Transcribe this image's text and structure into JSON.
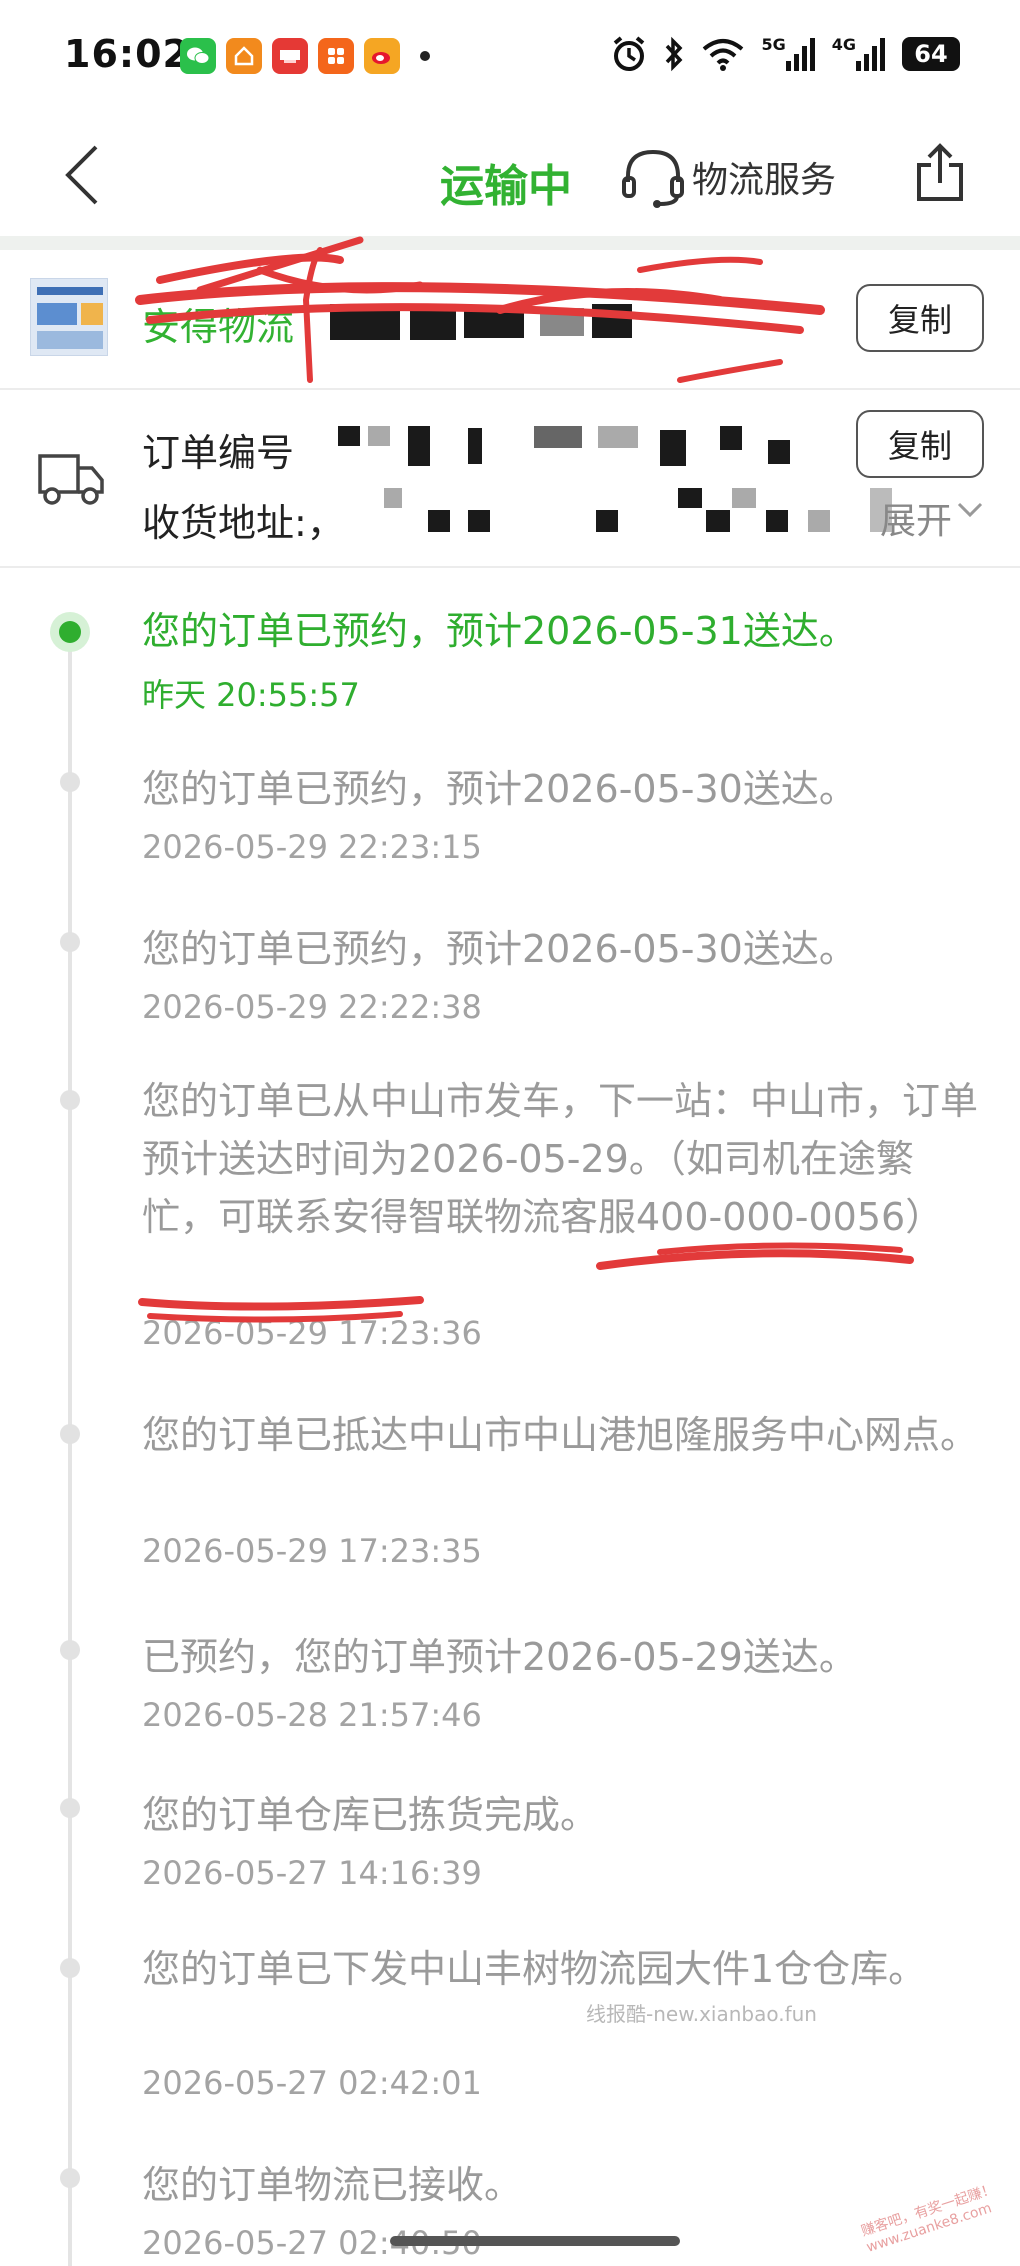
{
  "status_bar": {
    "time": "16:02",
    "network_5g": "5G",
    "network_4g": "4G",
    "battery": "64"
  },
  "nav": {
    "title": "运输中",
    "service_label": "物流服务"
  },
  "carrier": {
    "name": "安得物流",
    "copy_label": "复制"
  },
  "order": {
    "order_label": "订单编号",
    "address_label": "收货地址:，",
    "expand_label": "展开",
    "copy_label": "复制"
  },
  "timeline": [
    {
      "text": "您的订单已预约，预计2026-05-31送达。",
      "time": "昨天 20:55:57",
      "active": true
    },
    {
      "text": "您的订单已预约，预计2026-05-30送达。",
      "time": "2026-05-29 22:23:15"
    },
    {
      "text": "您的订单已预约，预计2026-05-30送达。",
      "time": "2026-05-29 22:22:38"
    },
    {
      "text": "您的订单已从中山市发车，下一站：中山市，订单预计送达时间为2026-05-29。（如司机在途繁忙，可联系安得智联物流客服400-000-0056）",
      "time": "2026-05-29 17:23:36"
    },
    {
      "text": "您的订单已抵达中山市中山港旭隆服务中心网点。",
      "time": "2026-05-29 17:23:35"
    },
    {
      "text": "已预约，您的订单预计2026-05-29送达。",
      "time": "2026-05-28 21:57:46"
    },
    {
      "text": "您的订单仓库已拣货完成。",
      "time": "2026-05-27 14:16:39"
    },
    {
      "text": "您的订单已下发中山丰树物流园大件1仓仓库。",
      "time": "2026-05-27 02:42:01"
    },
    {
      "text": "您的订单物流已接收。",
      "time": "2026-05-27 02:40:50"
    }
  ],
  "watermark": "线报酷-new.xianbao.fun",
  "corner_mark": "赚客吧，有奖一起赚！www.zuanke8.com",
  "colors": {
    "accent_green": "#2fae2f",
    "muted_text": "#9a9a9a",
    "scribble_red": "#e23a3a"
  }
}
